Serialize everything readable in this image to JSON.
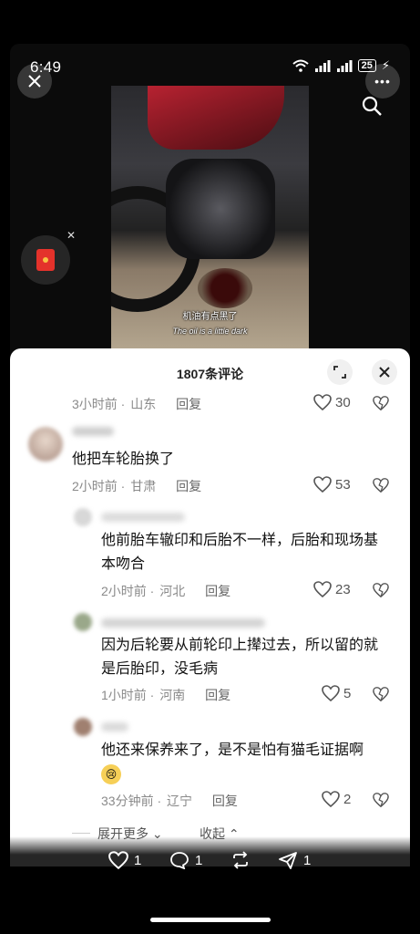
{
  "status_bar": {
    "time": "6:49",
    "battery": "25"
  },
  "video": {
    "subtitle_zh": "机油有点黑了",
    "subtitle_en": "The oil is a little dark"
  },
  "comments_sheet": {
    "title": "1807条评论",
    "comments": [
      {
        "time": "3小时前",
        "location": "山东",
        "reply_label": "回复",
        "likes": "30"
      },
      {
        "text": "他把车轮胎换了",
        "time": "2小时前",
        "location": "甘肃",
        "reply_label": "回复",
        "likes": "53"
      },
      {
        "text_line1": "他前胎车辙印和后胎不一样，后胎和现场基",
        "text_line2": "本吻合",
        "time": "2小时前",
        "location": "河北",
        "reply_label": "回复",
        "likes": "23"
      },
      {
        "text_line1": "因为后轮要从前轮印上撵过去，所以留的就",
        "text_line2": "是后胎印，没毛病",
        "time": "1小时前",
        "location": "河南",
        "reply_label": "回复",
        "likes": "5"
      },
      {
        "text": "他还来保养来了，是不是怕有猫毛证据啊",
        "time": "33分钟前",
        "location": "辽宁",
        "reply_label": "回复",
        "likes": "2"
      }
    ],
    "expand_label": "展开更多",
    "collapse_label": "收起"
  },
  "action_bar": {
    "likes": "1",
    "comments": "1",
    "reposts_icon": "repost-icon",
    "shares": "1"
  },
  "colors": {
    "accent_red": "#e4322b",
    "sheet_bg": "#ffffff"
  }
}
